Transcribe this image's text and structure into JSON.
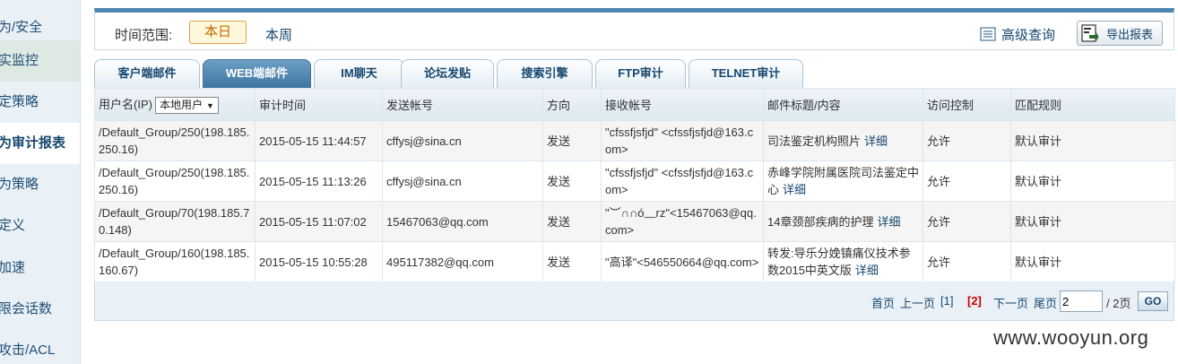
{
  "sidebar": {
    "items": [
      {
        "label": "为/安全"
      },
      {
        "label": "实监控"
      },
      {
        "label": "定策略"
      },
      {
        "label": "为审计报表"
      },
      {
        "label": "为策略"
      },
      {
        "label": "定义"
      },
      {
        "label": "加速"
      },
      {
        "label": "限会话数"
      },
      {
        "label": "攻击/ACL"
      }
    ]
  },
  "topbar": {
    "time_range_label": "时间范围:",
    "today": "本日",
    "week": "本周",
    "advanced_query": "高级查询",
    "export_report": "导出报表"
  },
  "tabs": [
    {
      "label": "客户端邮件"
    },
    {
      "label": "WEB端邮件"
    },
    {
      "label": "IM聊天"
    },
    {
      "label": "论坛发贴"
    },
    {
      "label": "搜索引擎"
    },
    {
      "label": "FTP审计"
    },
    {
      "label": "TELNET审计"
    }
  ],
  "table": {
    "headers": {
      "user": "用户名(IP)",
      "user_select": "本地用户",
      "time": "审计时间",
      "sender": "发送帐号",
      "direction": "方向",
      "receiver": "接收帐号",
      "subject": "邮件标题/内容",
      "access": "访问控制",
      "rule": "匹配规则"
    },
    "detail_label": "详细",
    "rows": [
      {
        "user": "/Default_Group/250(198.185.250.16)",
        "time": "2015-05-15 11:44:57",
        "sender": "cffysj@sina.cn",
        "direction": "发送",
        "receiver": "\"cfssfjsfjd\" <cfssfjsfjd@163.com>",
        "subject": "司法鉴定机构照片",
        "access": "允许",
        "rule": "默认审计"
      },
      {
        "user": "/Default_Group/250(198.185.250.16)",
        "time": "2015-05-15 11:13:26",
        "sender": "cffysj@sina.cn",
        "direction": "发送",
        "receiver": "\"cfssfjsfjd\" <cfssfjsfjd@163.com>",
        "subject": "赤峰学院附属医院司法鉴定中心",
        "access": "允许",
        "rule": "默认审计"
      },
      {
        "user": "/Default_Group/70(198.185.70.148)",
        "time": "2015-05-15 11:07:02",
        "sender": "15467063@qq.com",
        "direction": "发送",
        "receiver": "\"︶∩∩ó﹏rz\"<15467063@qq.com>",
        "subject": "14章颈部疾病的护理",
        "access": "允许",
        "rule": "默认审计"
      },
      {
        "user": "/Default_Group/160(198.185.160.67)",
        "time": "2015-05-15 10:55:28",
        "sender": "495117382@qq.com",
        "direction": "发送",
        "receiver": "\"高译\"<546550664@qq.com>",
        "subject": "转发:导乐分娩镇痛仪技术参数2015中英文版",
        "access": "允许",
        "rule": "默认审计"
      }
    ]
  },
  "pager": {
    "first": "首页",
    "prev": "上一页",
    "page1": "[1]",
    "page2": "[2]",
    "next": "下一页",
    "last": "尾页",
    "input_value": "2",
    "total": "/ 2页",
    "go": "GO"
  },
  "watermark": "www.wooyun.org"
}
